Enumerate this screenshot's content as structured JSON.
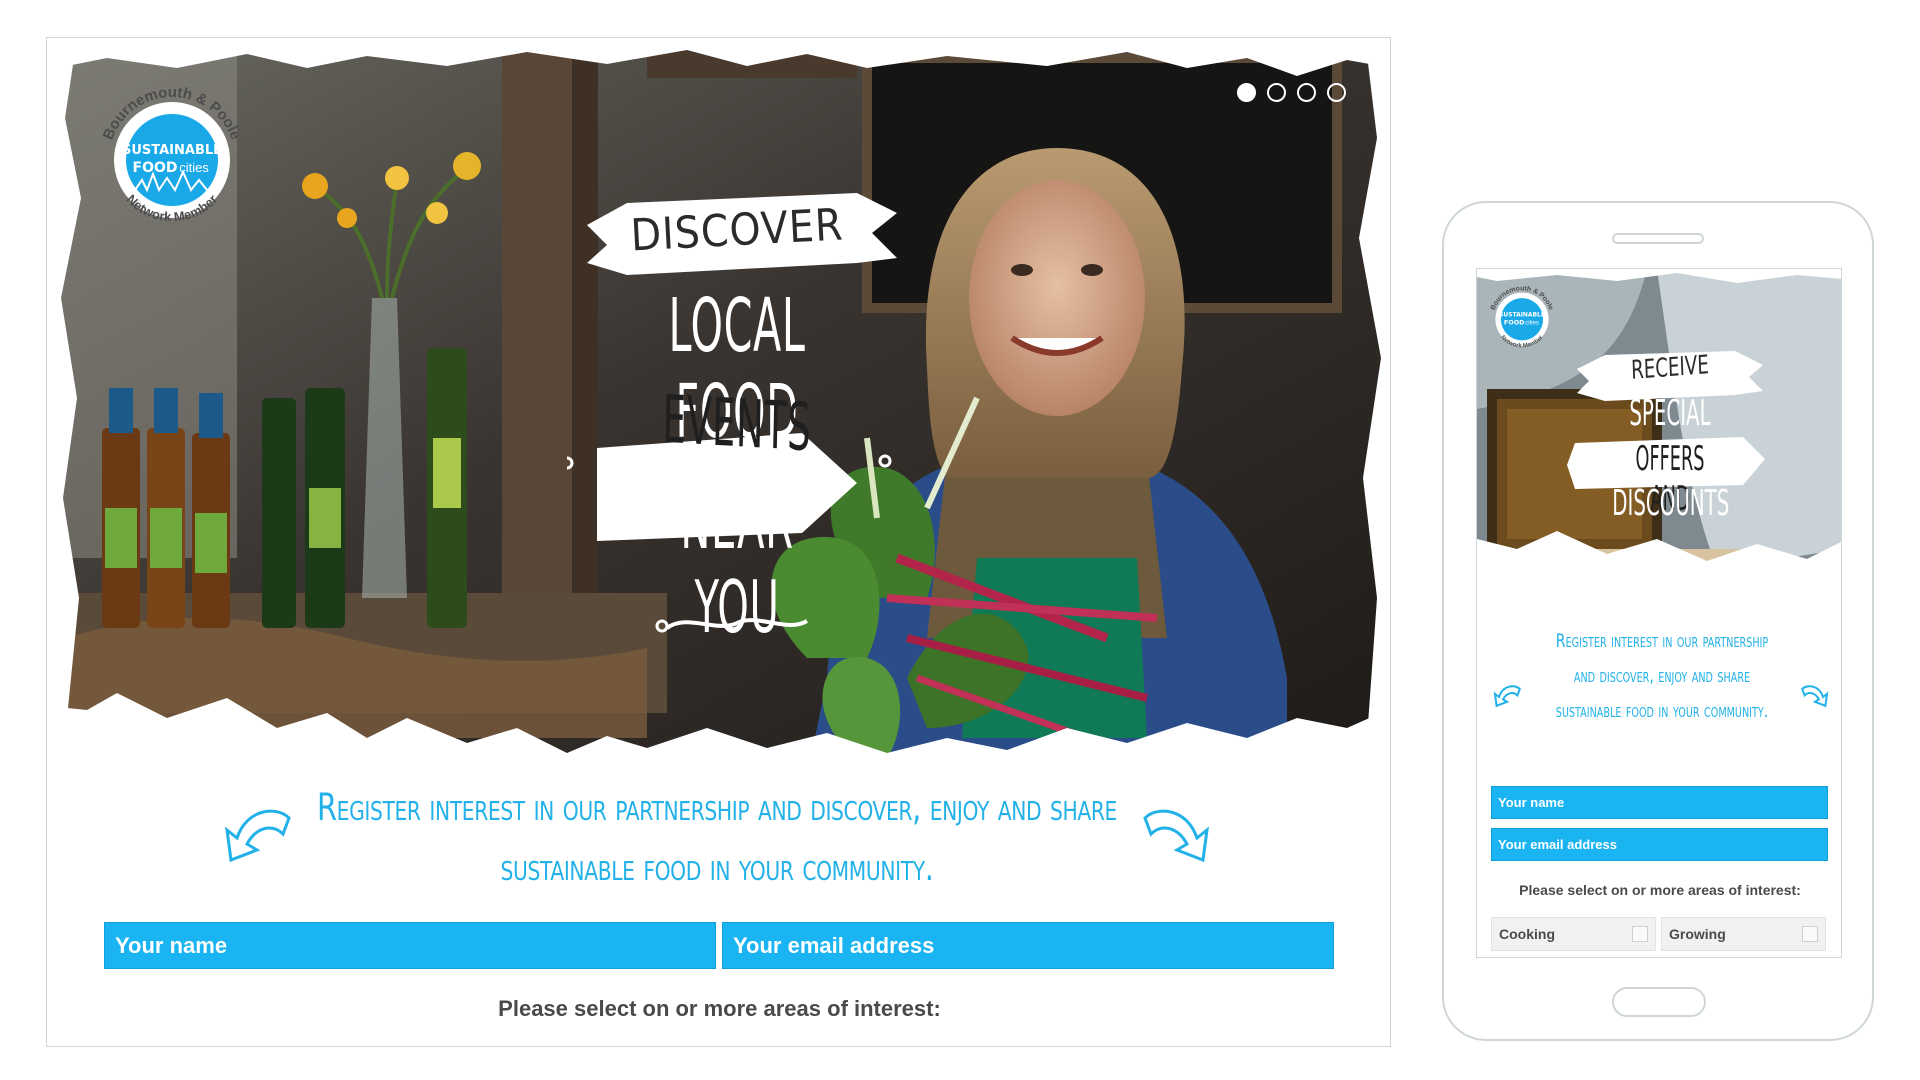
{
  "desktop": {
    "badge": {
      "ring_text_top": "Bournemouth & Poole",
      "ring_text_bottom": "Network Member",
      "line1": "SUSTAINABLE",
      "line2": "FOOD",
      "line3": "cities"
    },
    "hero": {
      "title_discover": "Discover",
      "title_local": "Local Food",
      "title_events": "Events",
      "title_near": "Near You",
      "slides": 4,
      "active_slide": 1
    },
    "tagline": "Register interest in our partnership and discover, enjoy and share sustainable food in your community.",
    "form": {
      "name_placeholder": "Your name",
      "email_placeholder": "Your email address",
      "interest_label": "Please select on or more areas of interest:"
    }
  },
  "mobile": {
    "badge": {
      "ring_text_top": "Bournemouth & Poole",
      "ring_text_bottom": "Network Member",
      "line1": "SUSTAINABLE",
      "line2": "FOOD",
      "line3": "cities"
    },
    "hero": {
      "title_receive": "Receive",
      "title_special": "Special",
      "title_offers": "Offers and",
      "title_discounts": "Discounts"
    },
    "tagline": "Register interest in our partnership and discover, enjoy and share sustainable food in your community.",
    "form": {
      "name_placeholder": "Your name",
      "email_placeholder": "Your email address",
      "interest_label": "Please select on or more areas of interest:",
      "options": [
        "Cooking",
        "Growing"
      ]
    }
  },
  "colors": {
    "brand_blue": "#19b4f1",
    "tagline_blue": "#22b1e8",
    "badge_blue": "#1aa9e8"
  }
}
